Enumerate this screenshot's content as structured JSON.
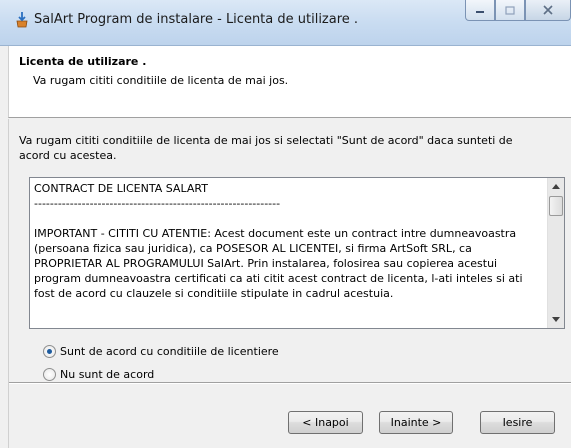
{
  "window": {
    "title": "SalArt Program de instalare - Licenta de utilizare .",
    "icon": "installer-icon"
  },
  "header": {
    "title": "Licenta de utilizare .",
    "subtitle": "Va rugam cititi conditiile de licenta de mai jos."
  },
  "main": {
    "intro": "Va rugam cititi conditiile de licenta de mai jos si selectati \"Sunt de acord\" daca sunteti de acord cu acestea.",
    "license_text": "CONTRACT DE LICENTA SALART\n--------------------------------------------------------------\n\nIMPORTANT - CITITI CU ATENTIE: Acest document este un contract intre dumneavoastra (persoana fizica sau juridica), ca POSESOR AL LICENTEI, si firma ArtSoft SRL, ca PROPRIETAR AL PROGRAMULUI SalArt. Prin instalarea, folosirea sau copierea acestui program dumneavoastra certificati ca ati citit acest contract de licenta, l-ati inteles si ati fost de acord cu clauzele si conditiile stipulate in cadrul acestuia.",
    "options": [
      {
        "label": "Sunt de acord cu conditiile de licentiere",
        "selected": true
      },
      {
        "label": "Nu sunt de acord",
        "selected": false
      }
    ]
  },
  "buttons": {
    "back": "< Inapoi",
    "next": "Inainte >",
    "exit": "Iesire"
  }
}
